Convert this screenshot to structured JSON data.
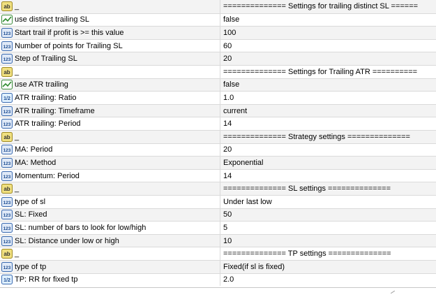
{
  "rows": [
    {
      "type": "string",
      "icon": "ab-string-icon",
      "name": "_",
      "value": "============== Settings for trailing distinct SL  ======"
    },
    {
      "type": "bool",
      "icon": "bool-chart-icon",
      "name": "use distinct trailing SL",
      "value": "false"
    },
    {
      "type": "int",
      "icon": "int-123-icon",
      "name": "Start trail if profit is >= this value",
      "value": "100"
    },
    {
      "type": "int",
      "icon": "int-123-icon",
      "name": "Number of points for Trailing SL",
      "value": "60"
    },
    {
      "type": "int",
      "icon": "int-123-icon",
      "name": "Step of Trailing SL",
      "value": "20"
    },
    {
      "type": "string",
      "icon": "ab-string-icon",
      "name": "_",
      "value": "============== Settings for Trailing ATR =========="
    },
    {
      "type": "bool",
      "icon": "bool-chart-icon",
      "name": "use ATR trailing",
      "value": "false"
    },
    {
      "type": "double",
      "icon": "double-half-icon",
      "name": "ATR trailing: Ratio",
      "value": "1.0"
    },
    {
      "type": "int",
      "icon": "int-123-icon",
      "name": "ATR trailing: Timeframe",
      "value": "current"
    },
    {
      "type": "int",
      "icon": "int-123-icon",
      "name": "ATR trailing: Period",
      "value": "14"
    },
    {
      "type": "string",
      "icon": "ab-string-icon",
      "name": "_",
      "value": "============== Strategy settings =============="
    },
    {
      "type": "int",
      "icon": "int-123-icon",
      "name": "MA: Period",
      "value": "20"
    },
    {
      "type": "int",
      "icon": "int-123-icon",
      "name": "MA: Method",
      "value": "Exponential"
    },
    {
      "type": "int",
      "icon": "int-123-icon",
      "name": "Momentum: Period",
      "value": "14"
    },
    {
      "type": "string",
      "icon": "ab-string-icon",
      "name": "_",
      "value": "============== SL settings =============="
    },
    {
      "type": "int",
      "icon": "int-123-icon",
      "name": "type of sl",
      "value": "Under last low"
    },
    {
      "type": "int",
      "icon": "int-123-icon",
      "name": "SL: Fixed",
      "value": "50"
    },
    {
      "type": "int",
      "icon": "int-123-icon",
      "name": "SL: number of bars to look for low/high",
      "value": "5"
    },
    {
      "type": "int",
      "icon": "int-123-icon",
      "name": "SL: Distance under low or high",
      "value": "10"
    },
    {
      "type": "string",
      "icon": "ab-string-icon",
      "name": "_",
      "value": "============== TP settings =============="
    },
    {
      "type": "int",
      "icon": "int-123-icon",
      "name": "type of tp",
      "value": "Fixed(if sl is fixed)"
    },
    {
      "type": "double",
      "icon": "double-half-icon",
      "name": "TP: RR for fixed tp",
      "value": "2.0"
    }
  ],
  "colors": {
    "string_icon_bg": "#f0e080",
    "string_icon_border": "#a08a20",
    "int_icon_bg": "#dfe9f7",
    "int_icon_border": "#3a6ab0",
    "bool_icon_border": "#3a8a3a",
    "double_icon_bg": "#dff0ff",
    "grid_line": "#dadada",
    "alt_row": "#f3f3f3"
  }
}
